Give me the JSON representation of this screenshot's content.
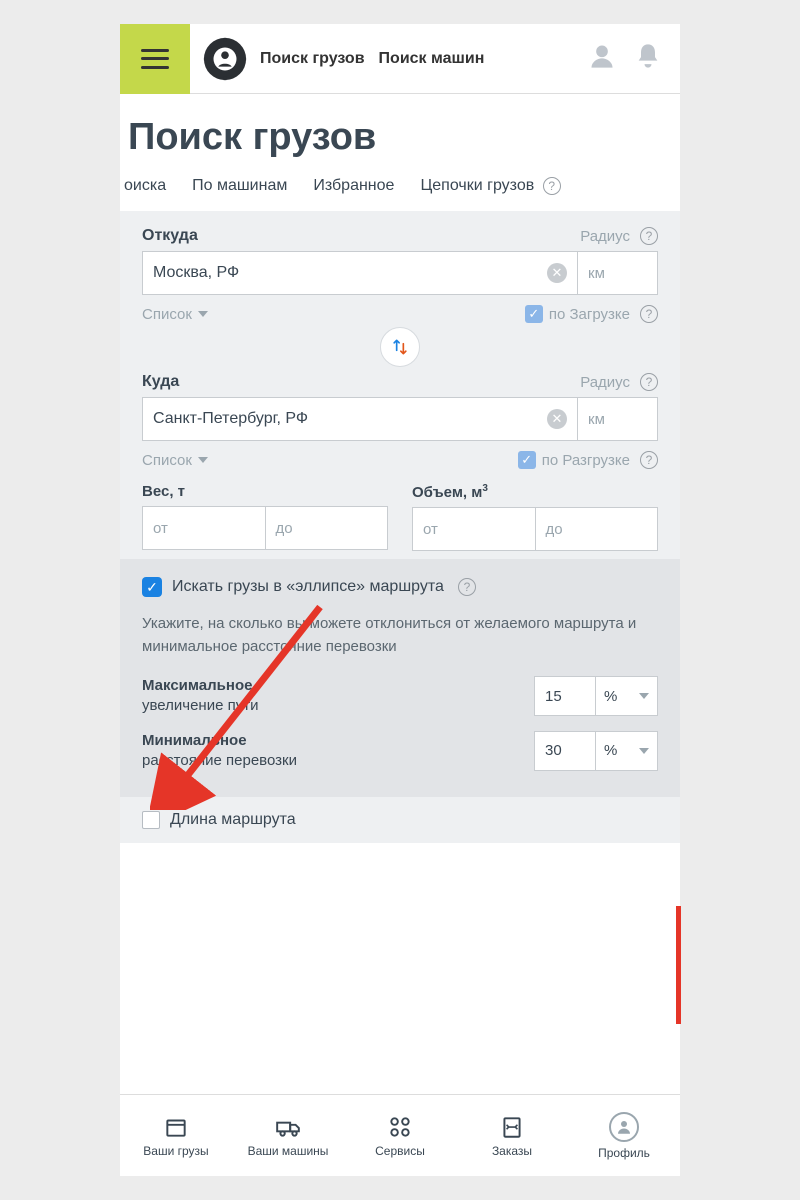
{
  "header": {
    "nav1": "Поиск грузов",
    "nav2": "Поиск машин"
  },
  "page_title": "Поиск грузов",
  "tabs": {
    "t0": "оиска",
    "t1": "По машинам",
    "t2": "Избранное",
    "t3": "Цепочки грузов"
  },
  "search": {
    "from_label": "Откуда",
    "radius_label": "Радиус",
    "from_value": "Москва, РФ",
    "km_placeholder": "км",
    "list_label": "Список",
    "by_load": "по Загрузке",
    "to_label": "Куда",
    "to_value": "Санкт-Петербург, РФ",
    "by_unload": "по Разгрузке",
    "weight_label": "Вес, т",
    "volume_label_a": "Объем, м",
    "volume_label_sup": "3",
    "from_ph": "от",
    "to_ph": "до"
  },
  "ellipse": {
    "checkbox_label": "Искать грузы в «эллипсе» маршрута",
    "desc": "Укажите, на сколько вы можете отклониться от желаемого маршрута и минимальное расстояние перевозки",
    "max_bold": "Максимальное",
    "max_rest": "увеличение пути",
    "max_value": "15",
    "min_bold": "Минимальное",
    "min_rest": "расстояние перевозки",
    "min_value": "30",
    "unit": "%"
  },
  "length_panel": {
    "label": "Длина маршрута"
  },
  "bottom_nav": {
    "i0": "Ваши грузы",
    "i1": "Ваши машины",
    "i2": "Сервисы",
    "i3": "Заказы",
    "i4": "Профиль"
  }
}
